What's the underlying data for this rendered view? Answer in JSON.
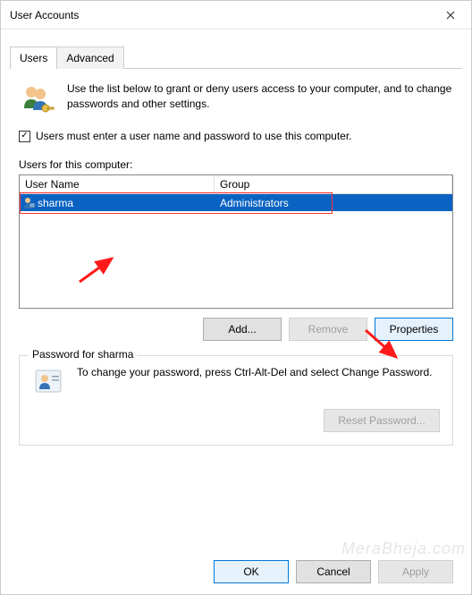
{
  "window": {
    "title": "User Accounts"
  },
  "tabs": {
    "users": "Users",
    "advanced": "Advanced"
  },
  "intro": "Use the list below to grant or deny users access to your computer, and to change passwords and other settings.",
  "require_login": {
    "checked": true,
    "label": "Users must enter a user name and password to use this computer."
  },
  "list_label": "Users for this computer:",
  "columns": {
    "user": "User Name",
    "group": "Group"
  },
  "users": [
    {
      "name": "sharma",
      "group": "Administrators"
    }
  ],
  "buttons": {
    "add": "Add...",
    "remove": "Remove",
    "properties": "Properties",
    "ok": "OK",
    "cancel": "Cancel",
    "apply": "Apply",
    "reset_password": "Reset Password..."
  },
  "password_box": {
    "legend": "Password for sharma",
    "text": "To change your password, press Ctrl-Alt-Del and select Change Password."
  },
  "watermark": "MeraBheja.com"
}
